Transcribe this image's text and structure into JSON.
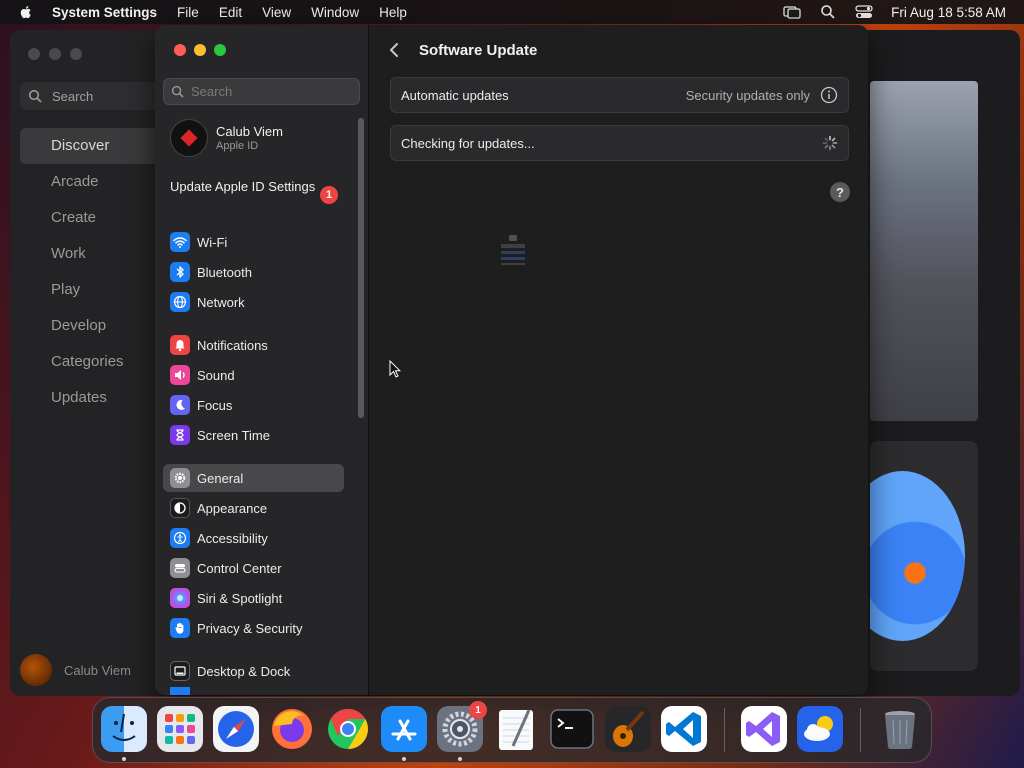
{
  "menubar": {
    "app_name": "System Settings",
    "menus": [
      "File",
      "Edit",
      "View",
      "Window",
      "Help"
    ],
    "clock": "Fri Aug 18  5:58 AM"
  },
  "appstore": {
    "search_label": "Search",
    "nav": [
      "Discover",
      "Arcade",
      "Create",
      "Work",
      "Play",
      "Develop",
      "Categories",
      "Updates"
    ],
    "active_nav": "Discover",
    "user_name": "Calub Viem"
  },
  "settings": {
    "search_placeholder": "Search",
    "profile": {
      "name": "Calub Viem",
      "subtitle": "Apple ID"
    },
    "update_apple_id": {
      "label": "Update Apple ID Settings",
      "badge": "1"
    },
    "sidebar_items": [
      {
        "label": "Wi-Fi",
        "icon": "wifi-icon",
        "color": "#1e7cf2"
      },
      {
        "label": "Bluetooth",
        "icon": "bluetooth-icon",
        "color": "#1e7cf2"
      },
      {
        "label": "Network",
        "icon": "globe-icon",
        "color": "#1e7cf2"
      },
      {
        "label": "Notifications",
        "icon": "bell-icon",
        "color": "#ef4444"
      },
      {
        "label": "Sound",
        "icon": "speaker-icon",
        "color": "#ec4899"
      },
      {
        "label": "Focus",
        "icon": "moon-icon",
        "color": "#6366f1"
      },
      {
        "label": "Screen Time",
        "icon": "hourglass-icon",
        "color": "#7c3aed"
      },
      {
        "label": "General",
        "icon": "gear-icon",
        "color": "#8e8e93"
      },
      {
        "label": "Appearance",
        "icon": "appearance-icon",
        "color": "#1c1c1e"
      },
      {
        "label": "Accessibility",
        "icon": "accessibility-icon",
        "color": "#1e7cf2"
      },
      {
        "label": "Control Center",
        "icon": "control-center-icon",
        "color": "#8e8e93"
      },
      {
        "label": "Siri & Spotlight",
        "icon": "siri-icon",
        "color": "#a855f7"
      },
      {
        "label": "Privacy & Security",
        "icon": "hand-icon",
        "color": "#1e7cf2"
      },
      {
        "label": "Desktop & Dock",
        "icon": "dock-icon",
        "color": "#1c1c1e"
      }
    ],
    "selected_item": "General",
    "content": {
      "title": "Software Update",
      "automatic_updates": {
        "label": "Automatic updates",
        "value": "Security updates only"
      },
      "status": "Checking for updates...",
      "help": "?"
    }
  },
  "dock": {
    "apps": [
      {
        "name": "Finder",
        "icon": "finder-icon",
        "running": true
      },
      {
        "name": "Launchpad",
        "icon": "launchpad-icon",
        "running": false
      },
      {
        "name": "Safari",
        "icon": "safari-icon",
        "running": false
      },
      {
        "name": "Firefox",
        "icon": "firefox-icon",
        "running": false
      },
      {
        "name": "Chrome",
        "icon": "chrome-icon",
        "running": false
      },
      {
        "name": "App Store",
        "icon": "app-store-icon",
        "running": true
      },
      {
        "name": "System Settings",
        "icon": "system-settings-icon",
        "running": true,
        "badge": "1"
      },
      {
        "name": "TextEdit",
        "icon": "textedit-icon",
        "running": false
      },
      {
        "name": "Terminal",
        "icon": "terminal-icon",
        "running": false
      },
      {
        "name": "GarageBand",
        "icon": "guitar-icon",
        "running": false
      },
      {
        "name": "Visual Studio Code",
        "icon": "vscode-icon",
        "running": false
      },
      {
        "name": "Visual Studio",
        "icon": "visual-studio-icon",
        "running": false
      },
      {
        "name": "Weather",
        "icon": "weather-icon",
        "running": false
      },
      {
        "name": "Trash",
        "icon": "trash-icon",
        "running": false
      }
    ]
  }
}
